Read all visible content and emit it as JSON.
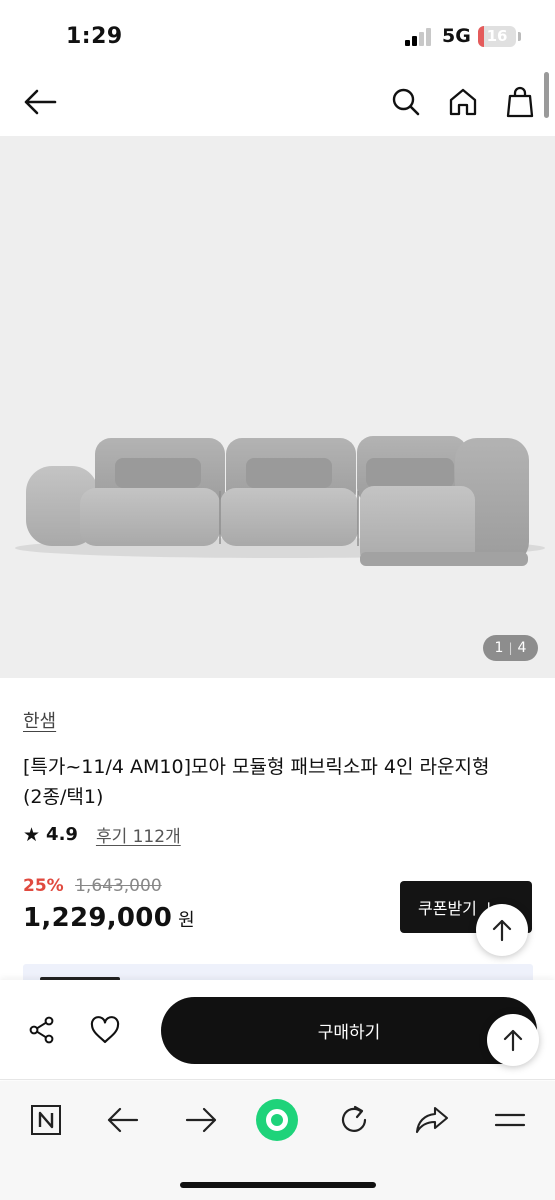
{
  "status_bar": {
    "time": "1:29",
    "network": "5G",
    "battery": "16",
    "battery_level": 0.16
  },
  "header": {
    "icons": [
      "back-arrow-icon",
      "search-icon",
      "home-icon",
      "shopping-bag-icon"
    ]
  },
  "product": {
    "image_counter": {
      "current": "1",
      "total": "4"
    },
    "brand": "한샘",
    "title": "[특가~11/4 AM10]모아 모듈형 패브릭소파 4인 라운지형(2종/택1)",
    "rating": {
      "star": "★",
      "score": "4.9",
      "reviews": "후기 112개"
    },
    "price": {
      "discount": "25%",
      "original": "1,643,000",
      "sale": "1,229,000",
      "unit": "원"
    },
    "coupon_label": "쿠폰받기 ↓"
  },
  "action_bar": {
    "buy_label": "구매하기",
    "icons": [
      "share-icon",
      "heart-icon",
      "scroll-top-icon"
    ]
  },
  "browser_bar": {
    "icons": [
      "naver-n-icon",
      "back-icon",
      "forward-icon",
      "green-dot-icon",
      "reload-icon",
      "share-arrow-icon",
      "menu-icon"
    ]
  },
  "colors": {
    "discount": "#e04a3f",
    "buy_button": "#111111",
    "image_bg": "#eeeeee",
    "green": "#1ed37a"
  }
}
